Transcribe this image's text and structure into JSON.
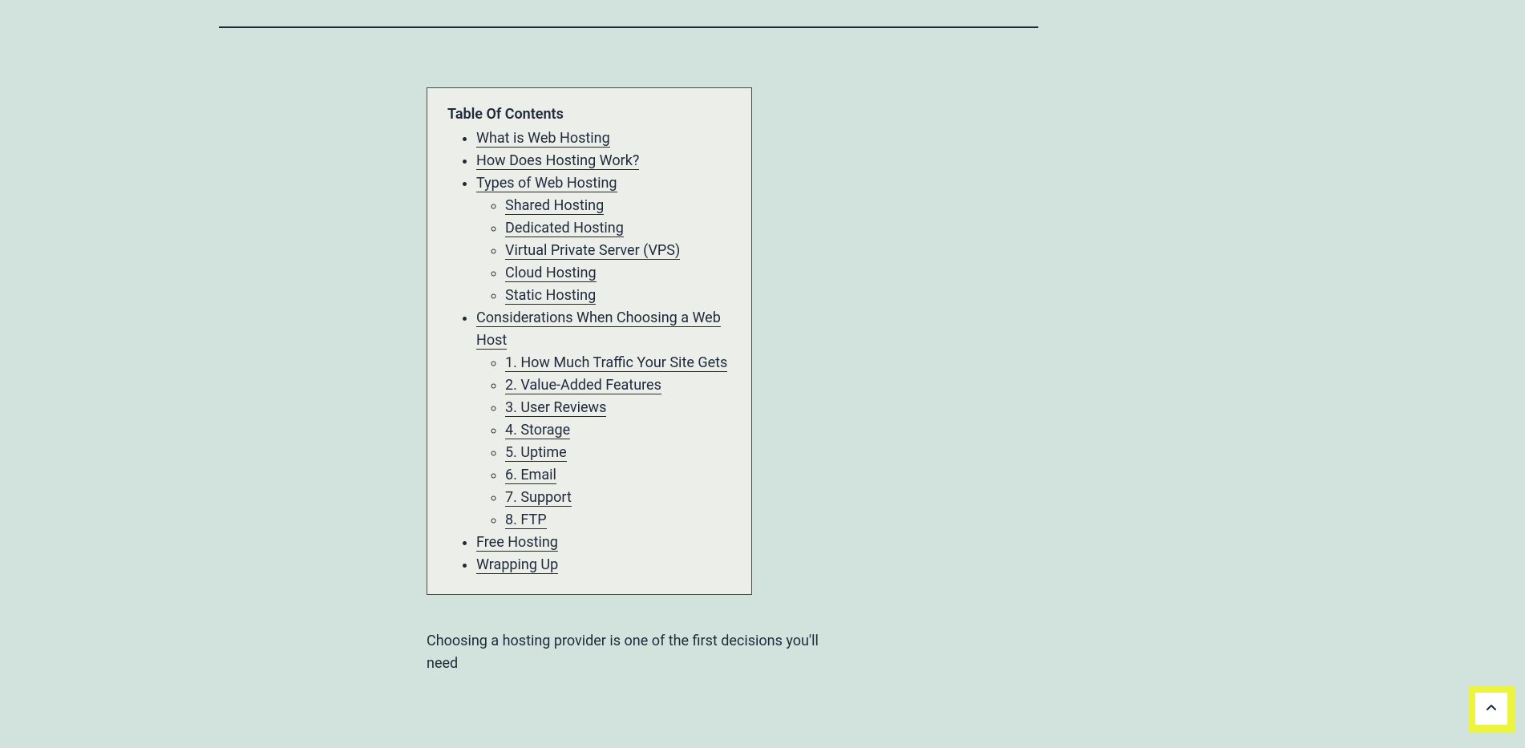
{
  "toc": {
    "title": "Table Of Contents",
    "items": [
      {
        "label": "What is Web Hosting"
      },
      {
        "label": "How Does Hosting Work?"
      },
      {
        "label": "Types of Web Hosting",
        "children": [
          {
            "label": "Shared Hosting"
          },
          {
            "label": "Dedicated Hosting"
          },
          {
            "label": "Virtual Private Server (VPS)"
          },
          {
            "label": "Cloud Hosting"
          },
          {
            "label": "Static Hosting"
          }
        ]
      },
      {
        "label": "Considerations When Choosing a Web Host",
        "children": [
          {
            "label": "1. How Much Traffic Your Site Gets"
          },
          {
            "label": "2. Value-Added Features"
          },
          {
            "label": "3. User Reviews"
          },
          {
            "label": "4. Storage"
          },
          {
            "label": "5. Uptime"
          },
          {
            "label": "6. Email"
          },
          {
            "label": "7. Support"
          },
          {
            "label": "8. FTP"
          }
        ]
      },
      {
        "label": "Free Hosting"
      },
      {
        "label": "Wrapping Up"
      }
    ]
  },
  "body": {
    "paragraph1": "Choosing a hosting provider is one of the first decisions you'll need"
  },
  "scrollTop": {
    "aria": "Scroll to top"
  }
}
